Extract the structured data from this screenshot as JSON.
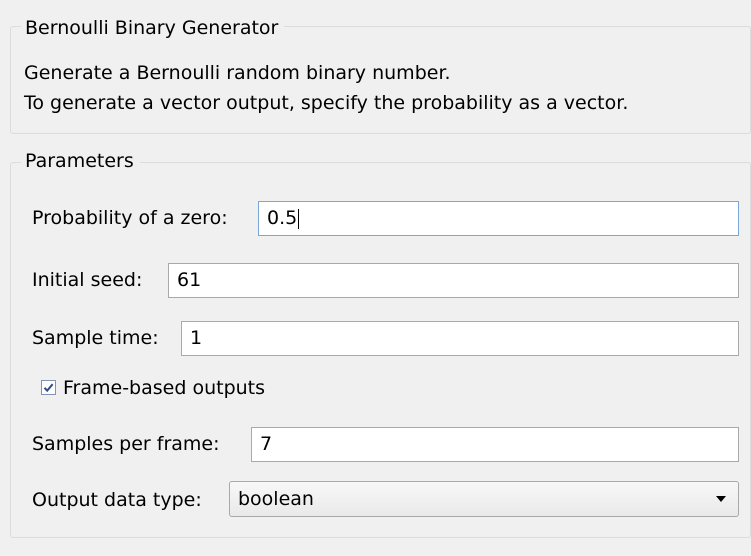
{
  "block": {
    "title": "Bernoulli Binary Generator",
    "description": [
      "Generate a Bernoulli random binary number.",
      "To generate a vector output, specify the probability as a vector."
    ]
  },
  "parameters": {
    "title": "Parameters",
    "probability_zero": {
      "label": "Probability of a zero:",
      "value": "0.5"
    },
    "initial_seed": {
      "label": "Initial seed:",
      "value": "61"
    },
    "sample_time": {
      "label": "Sample time:",
      "value": "1"
    },
    "frame_based": {
      "label": "Frame-based outputs",
      "checked": true
    },
    "samples_per_frame": {
      "label": "Samples per frame:",
      "value": "7"
    },
    "output_data_type": {
      "label": "Output data type:",
      "value": "boolean"
    }
  },
  "colors": {
    "background": "#f0f0f0",
    "group_border": "#dcdcdc",
    "field_border": "#a9a9a9",
    "focus_border": "#7aa7d6",
    "checkbox_check": "#2b4c8c"
  },
  "icons": {
    "checkbox": "check-mark",
    "dropdown": "chevron-down"
  }
}
